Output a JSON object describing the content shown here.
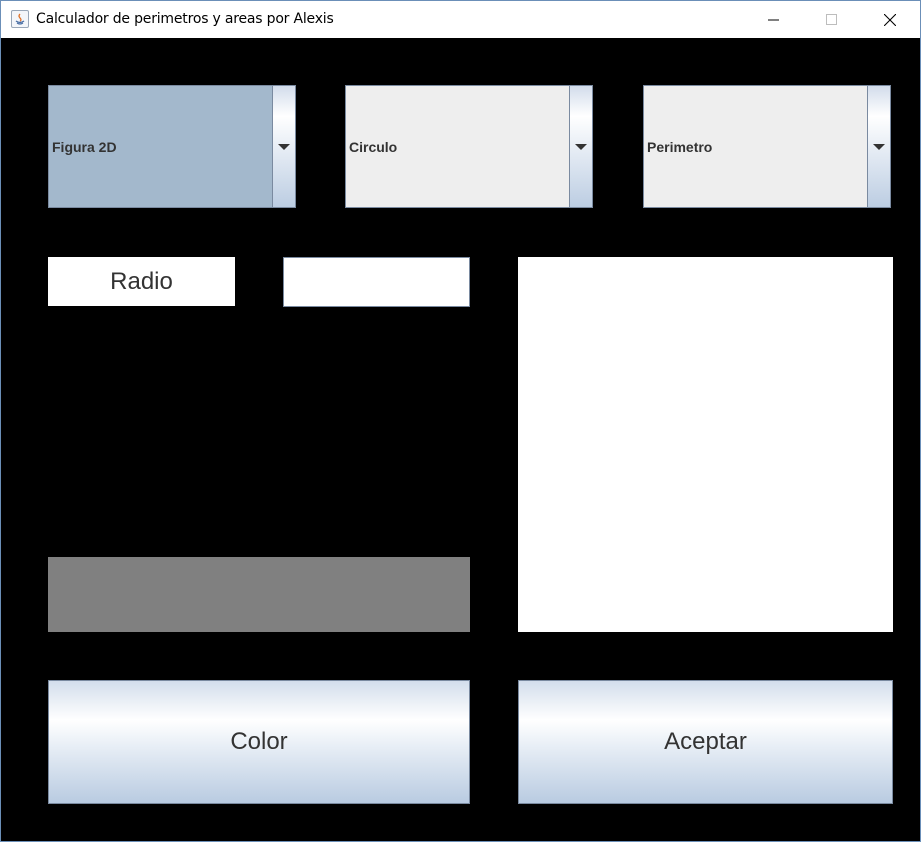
{
  "window": {
    "title": "Calculador de perimetros y areas por Alexis",
    "app_icon": "java-icon",
    "controls": [
      "minimize-icon",
      "maximize-icon",
      "close-icon"
    ]
  },
  "combos": {
    "dimension": {
      "value": "Figura 2D",
      "icon": "chevron-down-icon"
    },
    "figure": {
      "value": "Circulo",
      "icon": "chevron-down-icon"
    },
    "operation": {
      "value": "Perimetro",
      "icon": "chevron-down-icon"
    }
  },
  "input": {
    "label": "Radio",
    "value": ""
  },
  "preview": {
    "color": "#808080"
  },
  "buttons": {
    "color_label": "Color",
    "accept_label": "Aceptar"
  },
  "colors": {
    "background": "#000000",
    "combo_selected": "#a3b8cc",
    "combo_default": "#eeeeee",
    "canvas": "#ffffff"
  }
}
